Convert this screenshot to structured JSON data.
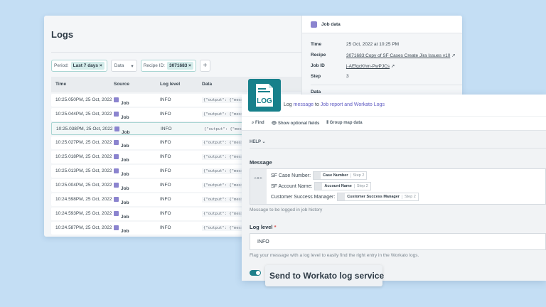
{
  "logs": {
    "title": "Logs",
    "filters": {
      "period_label": "Period:",
      "period_value": "Last 7 days",
      "data_select": "Data",
      "recipe_label": "Recipe ID:",
      "recipe_value": "3071683",
      "remove": "×",
      "add": "+"
    },
    "columns": [
      "Time",
      "Source",
      "Log level",
      "Data"
    ],
    "rows": [
      {
        "time": "10:25.050PM, 25 Oct, 2022",
        "source": "Job",
        "level": "INFO",
        "data": "{\"output\": {\"mess"
      },
      {
        "time": "10:25.044PM, 25 Oct, 2022",
        "source": "Job",
        "level": "INFO",
        "data": "{\"output\": {\"mess"
      },
      {
        "time": "10:25.038PM, 25 Oct, 2022",
        "source": "Job",
        "level": "INFO",
        "data": "{\"output\": {\"mess"
      },
      {
        "time": "10:25.027PM, 25 Oct, 2022",
        "source": "Job",
        "level": "INFO",
        "data": "{\"output\": {\"mess"
      },
      {
        "time": "10:25.018PM, 25 Oct, 2022",
        "source": "Job",
        "level": "INFO",
        "data": "{\"output\": {\"mess"
      },
      {
        "time": "10:25.013PM, 25 Oct, 2022",
        "source": "Job",
        "level": "INFO",
        "data": "{\"output\": {\"mess"
      },
      {
        "time": "10:25.004PM, 25 Oct, 2022",
        "source": "Job",
        "level": "INFO",
        "data": "{\"output\": {\"mess"
      },
      {
        "time": "10:24.598PM, 25 Oct, 2022",
        "source": "Job",
        "level": "INFO",
        "data": "{\"output\": {\"mess"
      },
      {
        "time": "10:24.593PM, 25 Oct, 2022",
        "source": "Job",
        "level": "INFO",
        "data": "{\"output\": {\"mess"
      },
      {
        "time": "10:24.587PM, 25 Oct, 2022",
        "source": "Job",
        "level": "INFO",
        "data": "{\"output\": {\"mess"
      }
    ]
  },
  "job_data": {
    "title": "Job data",
    "time_label": "Time",
    "time": "25 Oct, 2022 at 10:25 PM",
    "recipe_label": "Recipe",
    "recipe": "3071683:Copy of SF Cases Create Jira Issues v10",
    "job_id_label": "Job ID",
    "job_id": "j-AEfgcKhm-PwPJCs",
    "step_label": "Step",
    "step": "3",
    "data_label": "Data",
    "external": "↗"
  },
  "action": {
    "logo_text": "LOG",
    "pre": "Log",
    "link1": "message",
    "mid": "to",
    "link2": "Job report and Workato Logs",
    "toolbar": {
      "find": "Find",
      "optional": "Show optional fields",
      "group": "Group map data"
    },
    "help": "HELP ⌄",
    "message_label": "Message",
    "abc": "ABC",
    "lines": [
      {
        "label": "SF Case Number:",
        "pill": "Case Number",
        "step": "Step 2"
      },
      {
        "label": "SF Account Name:",
        "pill": "Account Name",
        "step": "Step 2"
      },
      {
        "label": "Customer Success Manager:",
        "pill": "Customer Success Manager",
        "step": "Step 2"
      }
    ],
    "message_hint": "Message to be logged in job history",
    "level_label": "Log level",
    "required": "*",
    "level_value": "INFO",
    "level_hint": "Flag your message with a log level to easily find the right entry in the Workato logs.",
    "tooltip": "Send to Workato log service"
  },
  "colors": {
    "teal": "#17808b",
    "purple": "#5e5ac2",
    "bg": "#c4def4"
  }
}
